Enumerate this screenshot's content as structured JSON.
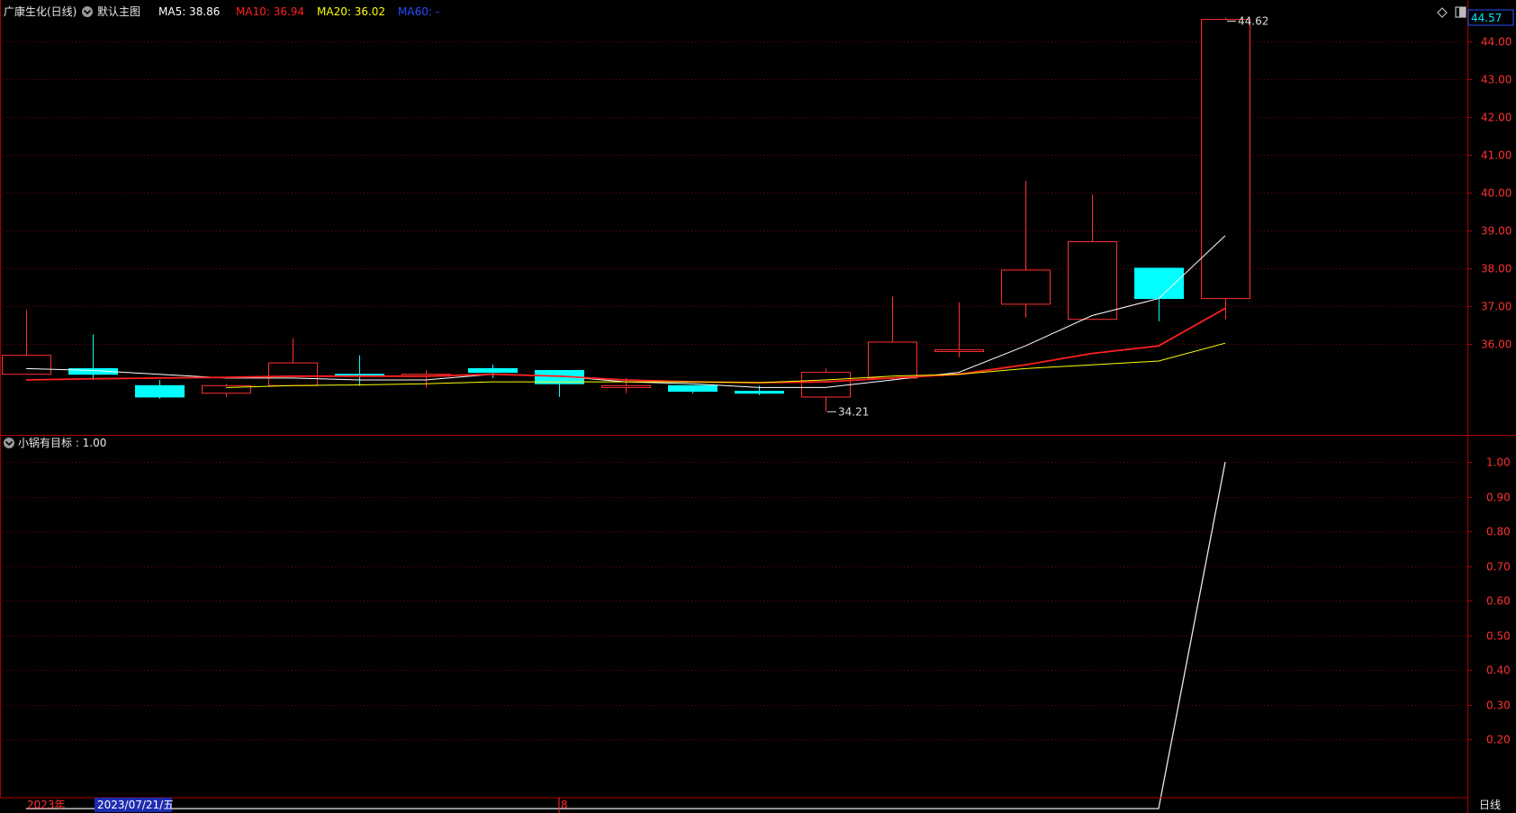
{
  "header": {
    "stock_name": "广康生化(日线)",
    "main_chart_label": "默认主图",
    "ma5": {
      "label": "MA5: 38.86",
      "color": "#ffffff"
    },
    "ma10": {
      "label": "MA10: 36.94",
      "color": "#ff2020"
    },
    "ma20": {
      "label": "MA20: 36.02",
      "color": "#ffff00"
    },
    "ma60": {
      "label": "MA60: -",
      "color": "#2a4cff"
    },
    "price_tag": "44.57"
  },
  "indicator": {
    "label": "小锅有目标 : 1.00",
    "ticks": [
      "1.00",
      "0.90",
      "0.80",
      "0.70",
      "0.60",
      "0.50",
      "0.40",
      "0.30",
      "0.20"
    ]
  },
  "footer": {
    "year_label": "2023年",
    "selected_date": "2023/07/21/五",
    "month_label": "8",
    "period_label": "日线"
  },
  "annotations": {
    "high": "44.62",
    "low": "34.21"
  },
  "colors": {
    "up": "#ff3030",
    "down": "#00ffff",
    "grid": "#7a0000",
    "frame": "#aa0000",
    "axis_text": "#ff3030"
  },
  "chart_data": {
    "type": "candlestick",
    "price_axis": {
      "ticks": [
        "44.00",
        "43.00",
        "42.00",
        "41.00",
        "40.00",
        "39.00",
        "38.00",
        "37.00",
        "36.00"
      ],
      "range": [
        33.6,
        44.75
      ]
    },
    "candles": [
      {
        "o": 35.2,
        "h": 36.9,
        "l": 35.2,
        "c": 35.7
      },
      {
        "o": 35.35,
        "h": 36.25,
        "l": 35.05,
        "c": 35.2
      },
      {
        "o": 34.9,
        "h": 35.05,
        "l": 34.55,
        "c": 34.6
      },
      {
        "o": 34.7,
        "h": 34.95,
        "l": 34.6,
        "c": 34.9
      },
      {
        "o": 34.9,
        "h": 36.15,
        "l": 34.9,
        "c": 35.5
      },
      {
        "o": 35.2,
        "h": 35.7,
        "l": 34.9,
        "c": 35.15
      },
      {
        "o": 35.15,
        "h": 35.3,
        "l": 34.85,
        "c": 35.2
      },
      {
        "o": 35.35,
        "h": 35.45,
        "l": 35.1,
        "c": 35.25
      },
      {
        "o": 35.3,
        "h": 35.3,
        "l": 34.6,
        "c": 34.95
      },
      {
        "o": 34.85,
        "h": 35.1,
        "l": 34.7,
        "c": 34.9
      },
      {
        "o": 34.9,
        "h": 34.9,
        "l": 34.7,
        "c": 34.75
      },
      {
        "o": 34.75,
        "h": 34.9,
        "l": 34.65,
        "c": 34.7
      },
      {
        "o": 34.6,
        "h": 35.35,
        "l": 34.21,
        "c": 35.25
      },
      {
        "o": 35.1,
        "h": 37.25,
        "l": 35.05,
        "c": 36.05
      },
      {
        "o": 35.8,
        "h": 37.1,
        "l": 35.65,
        "c": 35.85
      },
      {
        "o": 37.05,
        "h": 40.3,
        "l": 36.7,
        "c": 37.95
      },
      {
        "o": 36.65,
        "h": 39.95,
        "l": 36.65,
        "c": 38.7
      },
      {
        "o": 38.0,
        "h": 38.0,
        "l": 36.6,
        "c": 37.2
      },
      {
        "o": 37.2,
        "h": 44.62,
        "l": 36.65,
        "c": 44.57
      }
    ],
    "ma_lines": {
      "MA5": [
        35.35,
        35.3,
        35.2,
        35.1,
        35.1,
        35.05,
        35.05,
        35.2,
        35.15,
        35.0,
        34.95,
        34.85,
        34.85,
        35.05,
        35.25,
        35.95,
        36.75,
        37.2,
        38.86
      ],
      "MA10": [
        35.05,
        35.08,
        35.1,
        35.12,
        35.15,
        35.15,
        35.15,
        35.2,
        35.15,
        35.05,
        35.0,
        34.98,
        35.0,
        35.1,
        35.2,
        35.45,
        35.75,
        35.95,
        36.94
      ],
      "MA20": [
        null,
        null,
        null,
        34.85,
        34.9,
        34.92,
        34.95,
        35.0,
        35.0,
        35.0,
        35.0,
        34.98,
        35.05,
        35.15,
        35.2,
        35.35,
        35.45,
        35.55,
        36.02
      ]
    },
    "indicator_values": [
      0,
      0,
      0,
      0,
      0,
      0,
      0,
      0,
      0,
      0,
      0,
      0,
      0,
      0,
      0,
      0,
      0,
      0,
      1
    ],
    "indicator_range": [
      0.06,
      1.06
    ]
  }
}
